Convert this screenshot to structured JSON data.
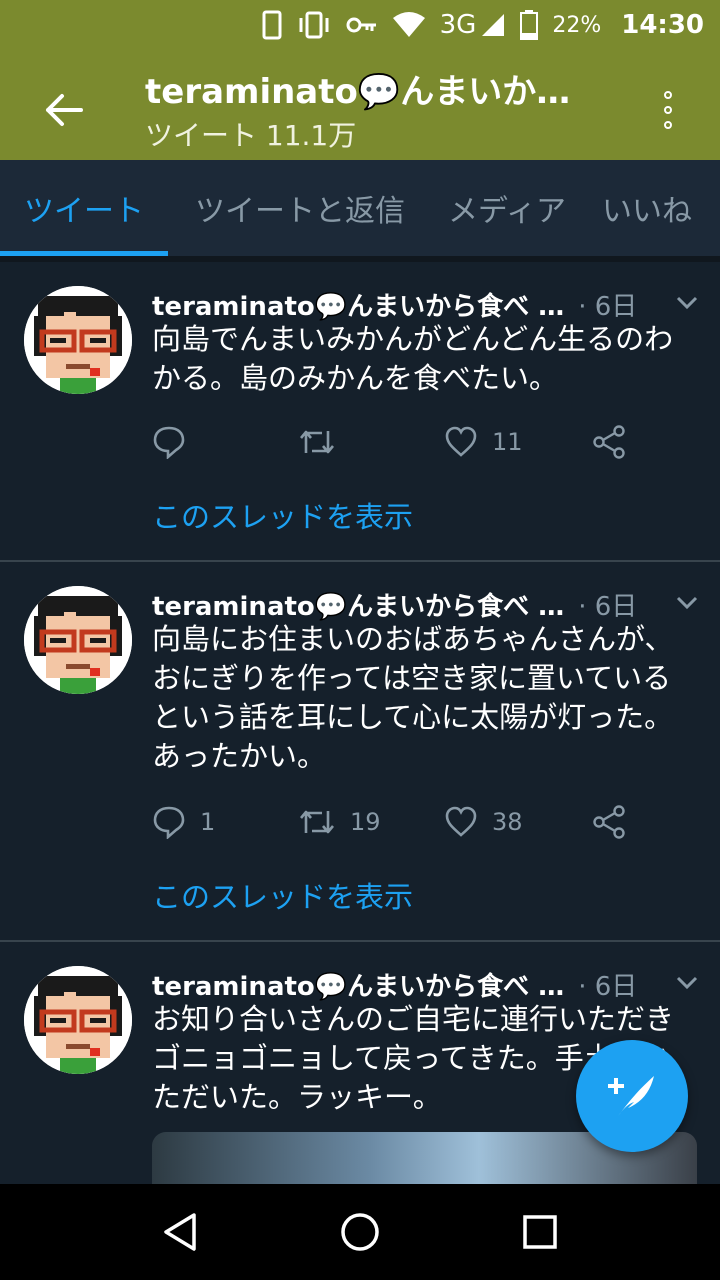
{
  "status_bar": {
    "network": "3G",
    "battery_percent": "22%",
    "time": "14:30"
  },
  "app_bar": {
    "title": "teraminato💬んまいか…",
    "subtitle": "ツイート 11.1万"
  },
  "tabs": [
    {
      "label": "ツイート",
      "active": true
    },
    {
      "label": "ツイートと返信",
      "active": false
    },
    {
      "label": "メディア",
      "active": false
    },
    {
      "label": "いいね",
      "active": false
    }
  ],
  "tweets": [
    {
      "name": "teraminato💬んまいから食べ …",
      "time": "· 6日",
      "text": "向島でんまいみかんがどんどん生るのわかる。島のみかんを食べたい。",
      "replies": "",
      "retweets": "",
      "likes": "11",
      "thread_link": "このスレッドを表示"
    },
    {
      "name": "teraminato💬んまいから食べ …",
      "time": "· 6日",
      "text": "向島にお住まいのおばあちゃんさんが、おにぎりを作っては空き家に置いているという話を耳にして心に太陽が灯った。あったかい。",
      "replies": "1",
      "retweets": "19",
      "likes": "38",
      "thread_link": "このスレッドを表示"
    },
    {
      "name": "teraminato💬んまいから食べ …",
      "time": "· 6日",
      "text": "お知り合いさんのご自宅に連行いただきゴニョゴニョして戻ってきた。手土産いただいた。ラッキー。"
    }
  ],
  "colors": {
    "header": "#7b8a2e",
    "background": "#15202b",
    "accent": "#1da1f2"
  },
  "icons": {
    "back": "arrow-left-icon",
    "more": "more-vertical-icon",
    "reply": "reply-icon",
    "retweet": "retweet-icon",
    "like": "heart-icon",
    "share": "share-icon",
    "compose": "compose-tweet-icon"
  }
}
